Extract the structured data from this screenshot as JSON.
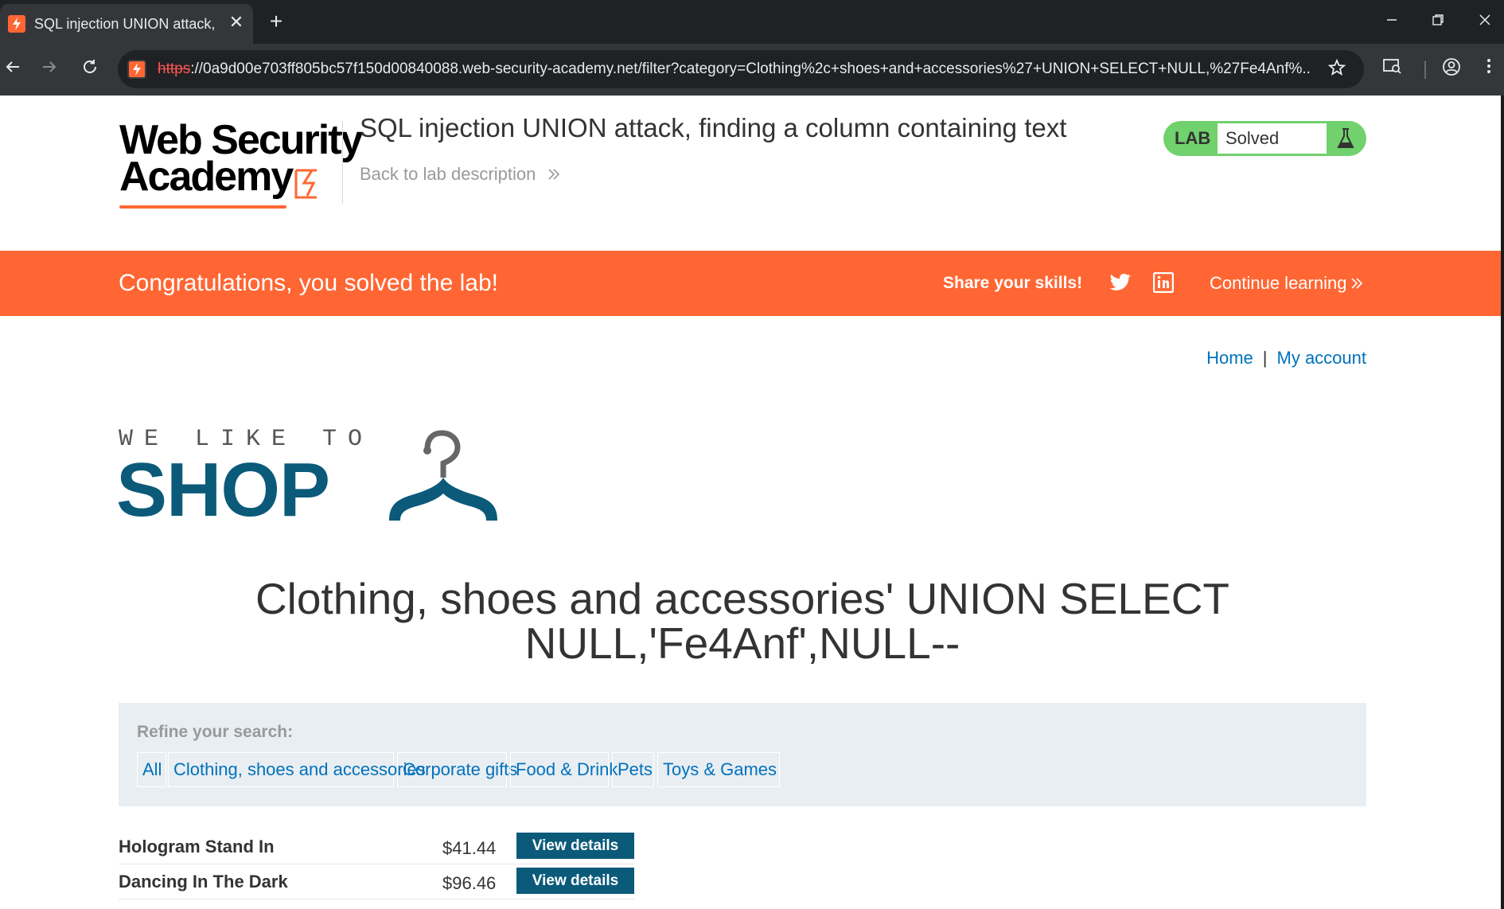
{
  "browser": {
    "tab_title": "SQL injection UNION attack, finding a column containing text",
    "tab_close": "✕",
    "new_tab": "+",
    "url_scheme": "https",
    "url_rest": "://0a9d00e703ff805bc57f150d00840088.web-security-academy.net/filter?category=Clothing%2c+shoes+and+accessories%27+UNION+SELECT+NULL,%27Fe4Anf%..."
  },
  "header": {
    "logo_line1": "Web Security",
    "logo_line2": "Academy",
    "lab_title": "SQL injection UNION attack, finding a column containing text",
    "back_link": "Back to lab description",
    "lab_label": "LAB",
    "lab_status": "Solved"
  },
  "banner": {
    "message": "Congratulations, you solved the lab!",
    "share": "Share your skills!",
    "continue": "Continue learning"
  },
  "nav": {
    "home": "Home",
    "separator": "|",
    "account": "My account"
  },
  "shop_logo": {
    "tagline": "WE LIKE TO",
    "word": "SHOP"
  },
  "category_heading": "Clothing, shoes and accessories' UNION SELECT NULL,'Fe4Anf',NULL--",
  "filters": {
    "label": "Refine your search:",
    "items": [
      "All",
      "Clothing, shoes and accessories",
      "Corporate gifts",
      "Food & Drink",
      "Pets",
      "Toys & Games"
    ]
  },
  "products": [
    {
      "name": "Hologram Stand In",
      "price": "$41.44",
      "action": "View details"
    },
    {
      "name": "Dancing In The Dark",
      "price": "$96.46",
      "action": "View details"
    }
  ],
  "colors": {
    "brand_orange": "#ff6633",
    "shop_blue": "#0b5a7a",
    "link_blue": "#0071bc",
    "lab_green": "#70d16d"
  }
}
